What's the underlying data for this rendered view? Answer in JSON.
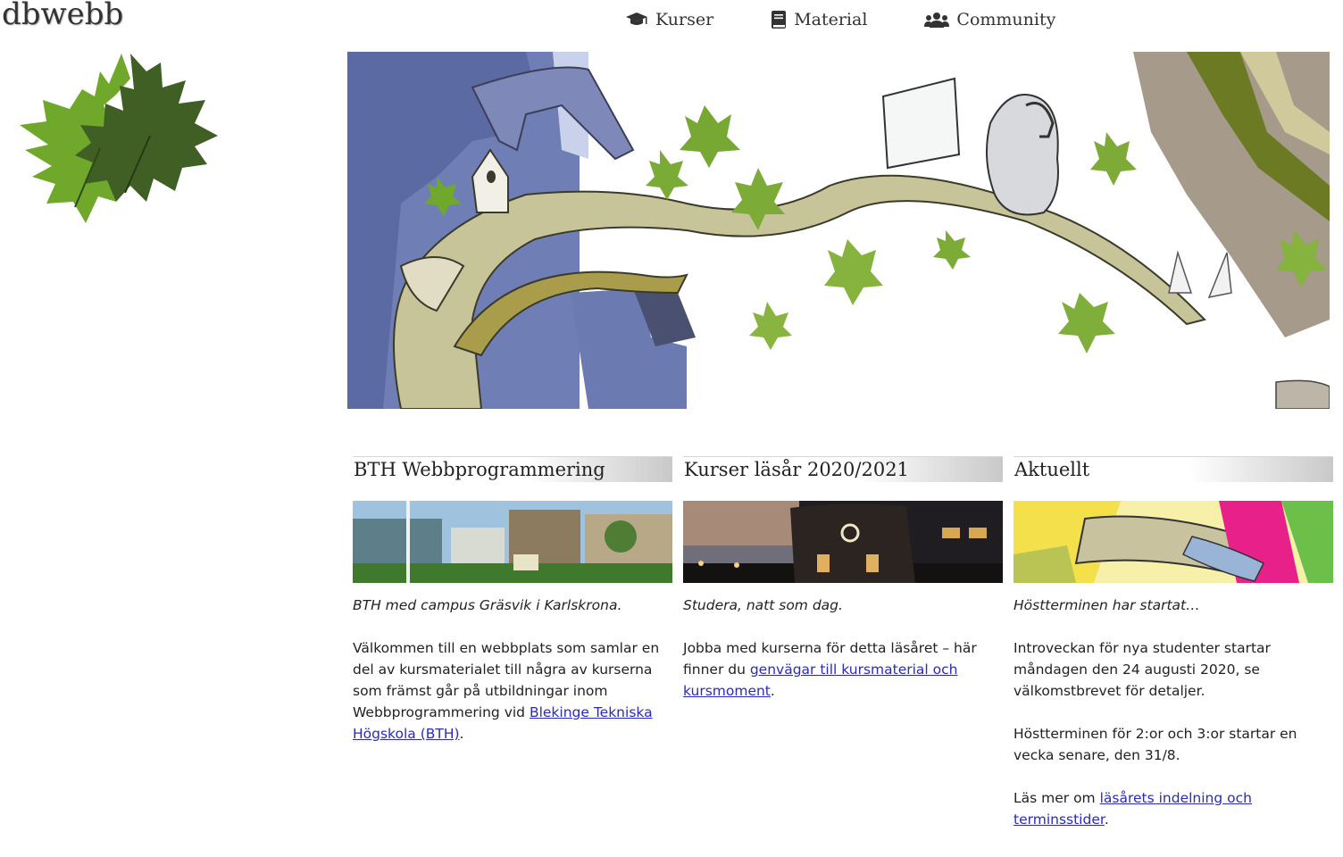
{
  "site": {
    "title": "dbwebb"
  },
  "nav": [
    {
      "label": "Kurser",
      "icon": "graduation-cap-icon"
    },
    {
      "label": "Material",
      "icon": "book-icon"
    },
    {
      "label": "Community",
      "icon": "users-icon"
    }
  ],
  "columns": [
    {
      "title": "BTH Webbprogrammering",
      "caption": "BTH med campus Gräsvik i Karlskrona.",
      "paragraphs": [
        {
          "pre": "Välkommen till en webbplats som samlar en del av kursmaterialet till några av kurserna som främst går på utbildningar inom Webbprogrammering vid ",
          "link": "Blekinge Tekniska Högskola (BTH)",
          "post": "."
        }
      ]
    },
    {
      "title": "Kurser läsår 2020/2021",
      "caption": "Studera, natt som dag.",
      "paragraphs": [
        {
          "pre": "Jobba med kurserna för detta läsåret – här finner du ",
          "link": "genvägar till kursmaterial och kursmoment",
          "post": "."
        }
      ]
    },
    {
      "title": "Aktuellt",
      "caption": "Höstterminen har startat…",
      "paragraphs": [
        {
          "pre": "Introveckan för nya studenter startar måndagen den 24 augusti 2020, se välkomstbrevet för detaljer.",
          "link": "",
          "post": ""
        },
        {
          "pre": "Höstterminen för 2:or och 3:or startar en vecka senare, den 31/8.",
          "link": "",
          "post": ""
        },
        {
          "pre": "Läs mer om ",
          "link": "läsårets indelning och terminsstider",
          "post": "."
        }
      ]
    }
  ],
  "colors": {
    "link": "#2a2ac0",
    "leaf_dark": "#3f5f25",
    "leaf_light": "#6fa82a",
    "heading_gradient": "#c9c9c9"
  }
}
